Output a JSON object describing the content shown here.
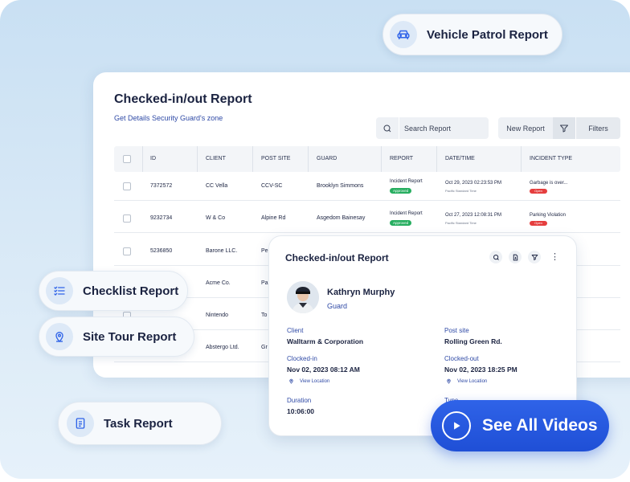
{
  "vehicle_patrol": {
    "label": "Vehicle Patrol Report",
    "icon": "car-icon"
  },
  "report": {
    "title": "Checked-in/out Report",
    "subtitle": "Get Details Security Guard's zone",
    "search_placeholder": "Search Report",
    "new_report_label": "New Report",
    "filters_label": "Filters",
    "columns": [
      "ID",
      "CLIENT",
      "POST SITE",
      "GUARD",
      "REPORT",
      "DATE/TIME",
      "INCIDENT TYPE"
    ],
    "rows": [
      {
        "id": "7372572",
        "client": "CC Vella",
        "post_site": "CCV-SC",
        "guard": "Brooklyn Simmons",
        "report": "Incident Report",
        "report_status": "Approved",
        "date": "Oct 29, 2023 02:23:53 PM",
        "timezone": "Pacific Standard Time",
        "incident": "Garbage is over...",
        "incident_status": "Open"
      },
      {
        "id": "9232734",
        "client": "W & Co",
        "post_site": "Alpine Rd",
        "guard": "Asgedom Bainesay",
        "report": "Incident Report",
        "report_status": "Approved",
        "date": "Oct 27, 2023 12:08:31 PM",
        "timezone": "Pacific Standard Time",
        "incident": "Parking Violation",
        "incident_status": "Open"
      },
      {
        "id": "5236850",
        "client": "Barone LLC.",
        "post_site": "Pe"
      },
      {
        "id": "",
        "client": "Acme Co.",
        "post_site": "Pa"
      },
      {
        "id": "",
        "client": "Nintendo",
        "post_site": "To"
      },
      {
        "id": "",
        "client": "Abstergo Ltd.",
        "post_site": "Gr"
      }
    ]
  },
  "side_pills": {
    "checklist": {
      "label": "Checklist Report",
      "icon": "checklist-icon"
    },
    "site_tour": {
      "label": "Site Tour Report",
      "icon": "location-pin-icon"
    },
    "task": {
      "label": "Task Report",
      "icon": "document-icon"
    }
  },
  "detail": {
    "title": "Checked-in/out Report",
    "name": "Kathryn Murphy",
    "role": "Guard",
    "client_label": "Client",
    "client_value": "Walltarm & Corporation",
    "post_site_label": "Post site",
    "post_site_value": "Rolling Green Rd.",
    "clocked_in_label": "Clocked-in",
    "clocked_in_value": "Nov 02, 2023 08:12 AM",
    "clocked_out_label": "Clocked-out",
    "clocked_out_value": "Nov 02, 2023 18:25 PM",
    "view_location": "View Location",
    "duration_label": "Duration",
    "duration_value": "10:06:00",
    "type_label": "Type"
  },
  "cta": {
    "label": "See All Videos",
    "icon": "play-icon"
  },
  "colors": {
    "accent": "#1f4fd6",
    "link": "#2f4aa6",
    "approved": "#27ae60",
    "open": "#e53e3e",
    "background": "#d2e6f5"
  }
}
